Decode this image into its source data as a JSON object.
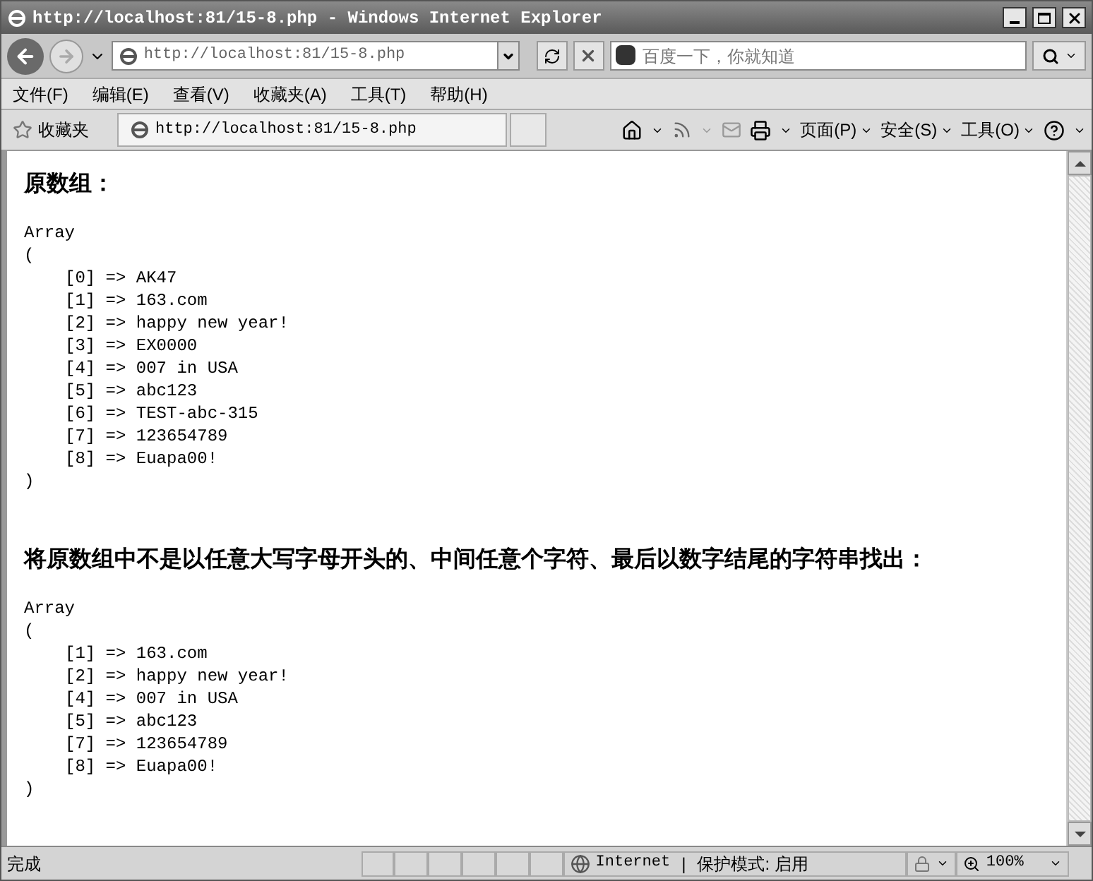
{
  "window": {
    "title": "http://localhost:81/15-8.php - Windows Internet Explorer"
  },
  "address_bar": {
    "url": "http://localhost:81/15-8.php"
  },
  "search": {
    "placeholder": "百度一下，你就知道"
  },
  "menu": [
    "文件(F)",
    "编辑(E)",
    "查看(V)",
    "收藏夹(A)",
    "工具(T)",
    "帮助(H)"
  ],
  "favorites_bar": {
    "label": "收藏夹",
    "tab": "http://localhost:81/15-8.php"
  },
  "command_bar": [
    "页面(P)",
    "安全(S)",
    "工具(O)"
  ],
  "sections": [
    {
      "heading": "原数组：",
      "open": "Array",
      "paren_open": "(",
      "items": [
        "[0] => AK47",
        "[1] => 163.com",
        "[2] => happy new year!",
        "[3] => EX0000",
        "[4] => 007 in USA",
        "[5] => abc123",
        "[6] => TEST-abc-315",
        "[7] => 123654789",
        "[8] => Euapa00!"
      ],
      "paren_close": ")"
    },
    {
      "heading": "将原数组中不是以任意大写字母开头的、中间任意个字符、最后以数字结尾的字符串找出：",
      "open": "Array",
      "paren_open": "(",
      "items": [
        "[1] => 163.com",
        "[2] => happy new year!",
        "[4] => 007 in USA",
        "[5] => abc123",
        "[7] => 123654789",
        "[8] => Euapa00!"
      ],
      "paren_close": ")"
    }
  ],
  "status_bar": {
    "status": "完成",
    "zone": "Internet",
    "separator": "|",
    "protected_mode": "保护模式: 启用",
    "zoom": "100%"
  }
}
